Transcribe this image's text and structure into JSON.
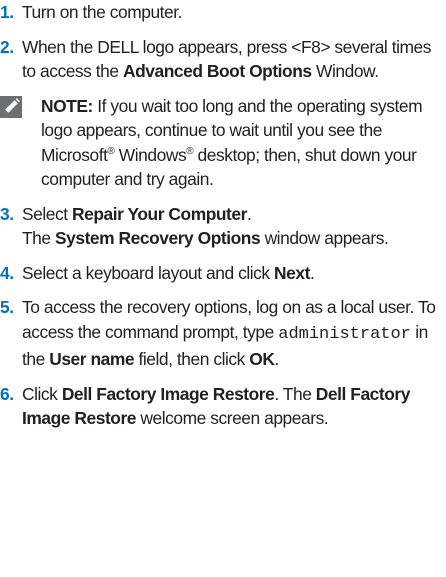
{
  "steps": [
    {
      "num": "1.",
      "text": "Turn on the computer."
    },
    {
      "num": "2.",
      "text_a": "When the DELL logo appears, press <F8> several times to access the ",
      "bold_a": "Advanced Boot Options",
      "text_b": " Window."
    },
    {
      "num": "3.",
      "text_a": "Select ",
      "bold_a": "Repair Your Computer",
      "text_b": ".",
      "line2_a": "The ",
      "line2_bold": "System Recovery Options",
      "line2_b": " window appears."
    },
    {
      "num": "4.",
      "text_a": "Select a keyboard layout and click ",
      "bold_a": "Next",
      "text_b": "."
    },
    {
      "num": "5.",
      "text_a": "To access the recovery options, log on as a local user. To access the command prompt, type ",
      "mono": "administrator",
      "text_b": " in the ",
      "bold_a": "User name",
      "text_c": " field, then click ",
      "bold_b": "OK",
      "text_d": "."
    },
    {
      "num": "6.",
      "text_a": "Click ",
      "bold_a": "Dell Factory Image Restore",
      "text_b": ". The ",
      "bold_b": "Dell Factory Image Restore",
      "text_c": " welcome screen appears."
    }
  ],
  "note": {
    "icon": "pencil-note-icon",
    "label": "NOTE:",
    "text_a": " If you wait too long and the operating system logo appears, continue to wait until you see the Microsoft",
    "reg1": "®",
    "text_b": " Windows",
    "reg2": "®",
    "text_c": " desktop; then, shut down your computer and try again."
  },
  "colors": {
    "step_number": "#0071b9",
    "text": "#231f20",
    "note_icon_bg": "#6d6e71"
  }
}
